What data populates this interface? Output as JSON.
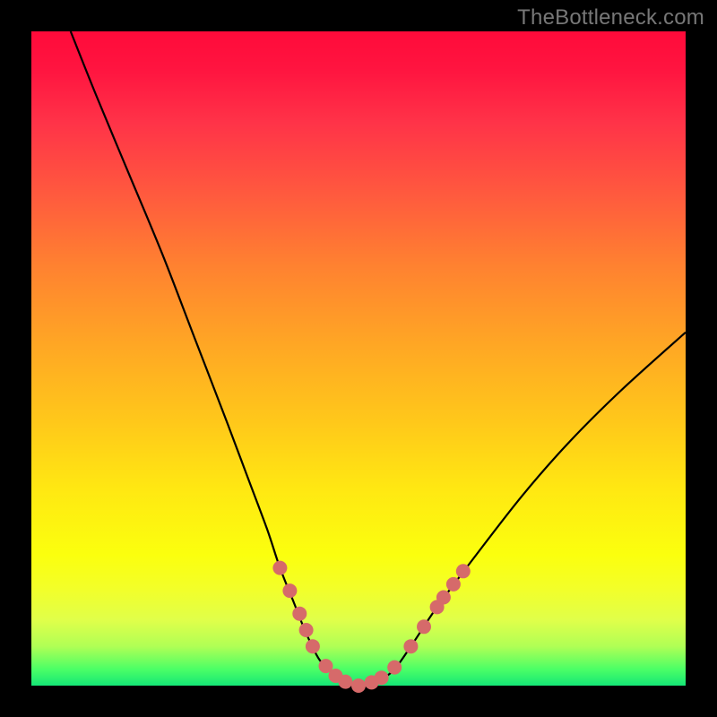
{
  "watermark": "TheBottleneck.com",
  "colors": {
    "background": "#000000",
    "marker": "#d66a6a",
    "curve": "#000000",
    "gradient_top": "#ff0a3a",
    "gradient_bottom": "#14e676"
  },
  "chart_data": {
    "type": "line",
    "title": "",
    "xlabel": "",
    "ylabel": "",
    "xlim": [
      0,
      100
    ],
    "ylim": [
      0,
      100
    ],
    "series": [
      {
        "name": "bottleneck-curve",
        "x": [
          6,
          10,
          15,
          20,
          25,
          30,
          33,
          36,
          38,
          40,
          42,
          44,
          46,
          48,
          50,
          52,
          55,
          58,
          62,
          68,
          75,
          82,
          90,
          100
        ],
        "y": [
          100,
          90,
          78,
          66,
          53,
          40,
          32,
          24,
          18,
          13,
          8,
          4,
          2,
          0.5,
          0,
          0.5,
          2,
          6,
          12,
          20,
          29,
          37,
          45,
          54
        ]
      }
    ],
    "markers": {
      "name": "highlighted-points",
      "points": [
        {
          "x": 38.0,
          "y": 18.0
        },
        {
          "x": 39.5,
          "y": 14.5
        },
        {
          "x": 41.0,
          "y": 11.0
        },
        {
          "x": 42.0,
          "y": 8.5
        },
        {
          "x": 43.0,
          "y": 6.0
        },
        {
          "x": 45.0,
          "y": 3.0
        },
        {
          "x": 46.5,
          "y": 1.5
        },
        {
          "x": 48.0,
          "y": 0.6
        },
        {
          "x": 50.0,
          "y": 0.0
        },
        {
          "x": 52.0,
          "y": 0.5
        },
        {
          "x": 53.5,
          "y": 1.2
        },
        {
          "x": 55.5,
          "y": 2.8
        },
        {
          "x": 58.0,
          "y": 6.0
        },
        {
          "x": 60.0,
          "y": 9.0
        },
        {
          "x": 62.0,
          "y": 12.0
        },
        {
          "x": 63.0,
          "y": 13.5
        },
        {
          "x": 64.5,
          "y": 15.5
        },
        {
          "x": 66.0,
          "y": 17.5
        }
      ]
    }
  }
}
